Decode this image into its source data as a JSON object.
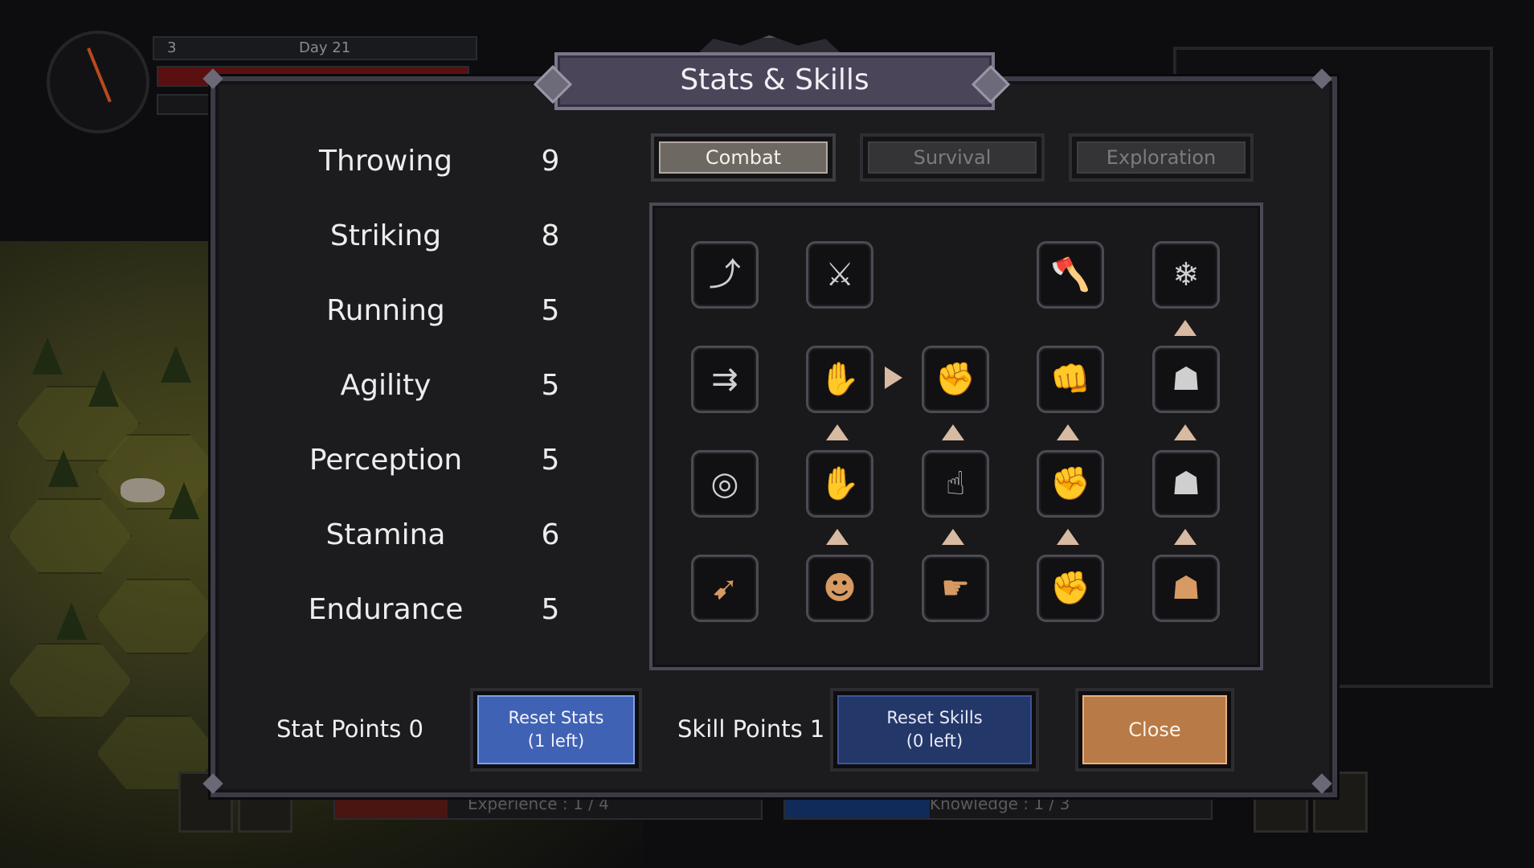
{
  "hud": {
    "level": "3",
    "day": "Day 21",
    "experience": "Experience : 1 / 4",
    "knowledge": "Knowledge : 1 / 3"
  },
  "dialog": {
    "title": "Stats & Skills"
  },
  "stats": [
    {
      "name": "Throwing",
      "value": "9"
    },
    {
      "name": "Striking",
      "value": "8"
    },
    {
      "name": "Running",
      "value": "5"
    },
    {
      "name": "Agility",
      "value": "5"
    },
    {
      "name": "Perception",
      "value": "5"
    },
    {
      "name": "Stamina",
      "value": "6"
    },
    {
      "name": "Endurance",
      "value": "5"
    }
  ],
  "tabs": [
    {
      "label": "Combat",
      "active": true
    },
    {
      "label": "Survival",
      "active": false
    },
    {
      "label": "Exploration",
      "active": false
    }
  ],
  "skills": {
    "row1": [
      "spear-thrower-icon",
      "spear-axe-icon",
      "",
      "hand-axe-plus-icon",
      "snowflake-star-icon"
    ],
    "row2": [
      "double-arrow-icon",
      "open-hand-icon",
      "fist-glow-icon",
      "punch-plus-icon",
      "body-stance-icon"
    ],
    "row3": [
      "target-icon",
      "grab-hand-icon",
      "throw-hand-icon",
      "fist-plus-icon",
      "body-sparkle-icon"
    ],
    "row4": [
      "arrows-icon",
      "face-icon",
      "pointing-hand-icon",
      "grip-fist-icon",
      "muscle-body-icon"
    ]
  },
  "footer": {
    "stat_points": "Stat Points 0",
    "reset_stats_line1": "Reset Stats",
    "reset_stats_line2": "(1 left)",
    "skill_points": "Skill Points 1",
    "reset_skills_line1": "Reset Skills",
    "reset_skills_line2": "(0 left)",
    "close": "Close"
  },
  "colors": {
    "dialog_bg": "#1c1c1f",
    "title_plate": "#4a4559",
    "tab_active": "#6e6862",
    "blue_button": "#4062b4",
    "blue_button_dark": "#243769",
    "close_button": "#b87a46",
    "upgrade_arrow": "#d8b9a2"
  }
}
